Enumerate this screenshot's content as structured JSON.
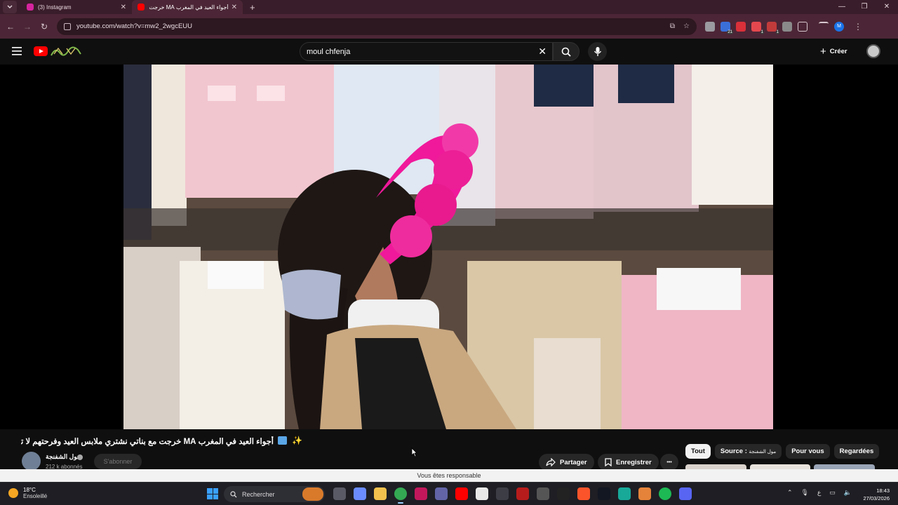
{
  "browser": {
    "tabs": [
      {
        "title": "(3) Instagram",
        "favicon_color": "#d6249f",
        "active": false
      },
      {
        "title": "أجواء العيد في المغرب MA خرجت",
        "favicon_color": "#ff0000",
        "active": true
      }
    ],
    "new_tab": "+",
    "url": "youtube.com/watch?v=mw2_2wgcEUU",
    "window_controls": [
      "—",
      "❐",
      "✕"
    ],
    "extension_badges": {
      "ext2": "21",
      "ext4": "1",
      "ext5": "1"
    },
    "profile_initial": "M"
  },
  "youtube": {
    "search_value": "moul chfenja",
    "create_label": "Créer",
    "video_title": "أجواء العيد في المغرب MA خرجت مع بناتي نشتري ملابس العيد وفرحتهم لا توصف",
    "channel": {
      "name": "مول الشفنجة",
      "subscribers": "212 k abonnés"
    },
    "subscribe_label": "S'abonner",
    "share_label": "Partager",
    "save_label": "Enregistrer",
    "more_label": "•••",
    "chips": [
      {
        "label": "Tout",
        "selected": true
      },
      {
        "label": "Source : ",
        "extra": "مول الشفنجة",
        "selected": false
      },
      {
        "label": "Pour vous",
        "selected": false
      },
      {
        "label": "Regardées",
        "selected": false
      }
    ],
    "disclaimer": "Vous êtes responsable"
  },
  "taskbar": {
    "weather_temp": "18°C",
    "weather_desc": "Ensoleillé",
    "search_label": "Rechercher",
    "tray_lang": "ع",
    "time": "18:43",
    "date": "27/03/2026"
  },
  "colors": {
    "accent_red": "#ff0000",
    "tab_bg": "#4c2636",
    "yt_bg": "#0f0f0f"
  }
}
